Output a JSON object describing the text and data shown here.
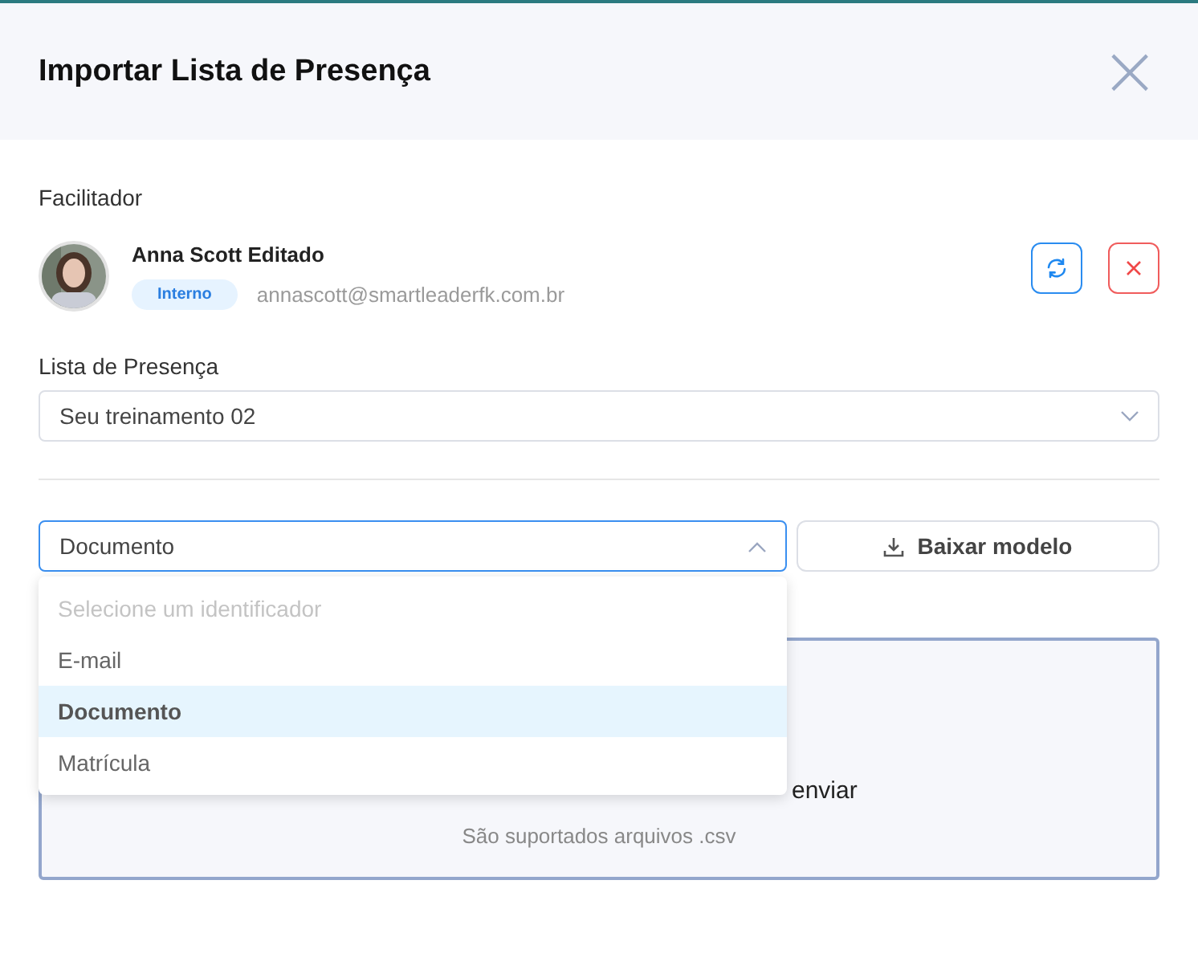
{
  "dialog": {
    "title": "Importar Lista de Presença",
    "close": "×"
  },
  "facilitator": {
    "label": "Facilitador",
    "name": "Anna Scott Editado",
    "badge": "Interno",
    "email": "annascott@smartleaderfk.com.br"
  },
  "attendance_list": {
    "label": "Lista de Presença",
    "value": "Seu treinamento 02"
  },
  "identifier": {
    "value": "Documento",
    "expanded": true,
    "prompt": "Selecione um identificador",
    "options": [
      {
        "label": "E-mail",
        "selected": false
      },
      {
        "label": "Documento",
        "selected": true
      },
      {
        "label": "Matrícula",
        "selected": false
      }
    ]
  },
  "download_button": "Baixar modelo",
  "upload": {
    "text": "enviar",
    "hint": "São suportados arquivos .csv"
  }
}
